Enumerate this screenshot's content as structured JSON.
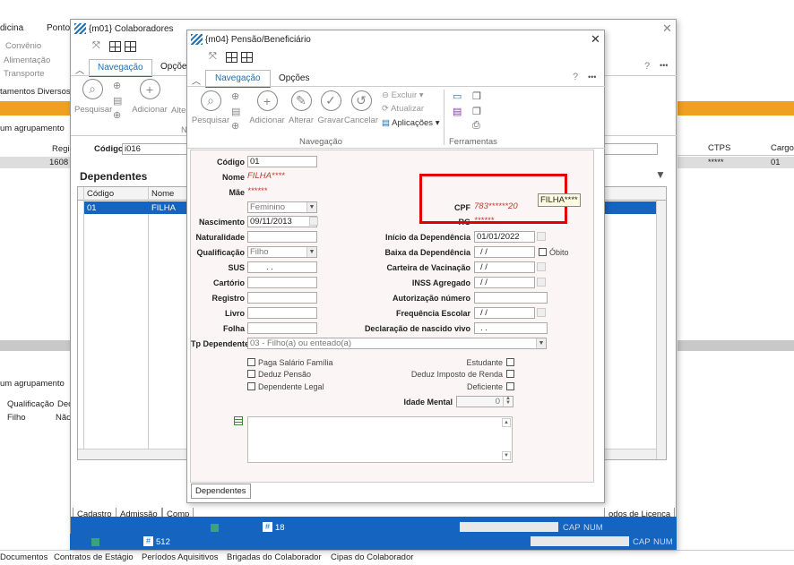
{
  "bg": {
    "menu": [
      "dicina",
      "Ponto"
    ],
    "side_items": [
      "Convênio",
      "Alimentação",
      "Transporte",
      "tamentos Diversos"
    ],
    "agrupamento1": "um agrupamento",
    "agrupamento2": "um agrupamento",
    "col_regi": "Regi",
    "row_value": "1608",
    "ctps_header": "CTPS",
    "cargo_header": "Cargo",
    "ctps_value": "*****",
    "cargo_value": "01",
    "qual_headers": [
      "Qualificação",
      "Dec"
    ],
    "qual_values": [
      "Filho",
      "Não"
    ],
    "bottom_links": [
      "Documentos",
      "Contratos de Estágio",
      "Períodos Aquisitivos",
      "Brigadas do Colaborador",
      "Cipas do Colaborador"
    ],
    "status_num": "512",
    "status_cap": "CAP",
    "status_num_label": "NUM"
  },
  "win1": {
    "title": "{m01} Colaboradores",
    "tab_nav": "Navegação",
    "tab_opc": "Opções",
    "pesquisar": "Pesquisar",
    "adicionar": "Adicionar",
    "alterar": "Alter",
    "n_label": "N",
    "codigo_label": "Código",
    "codigo_value": "i016",
    "dependentes_title": "Dependentes",
    "col_codigo": "Código",
    "col_nome": "Nome",
    "row_codigo": "01",
    "row_nome": "FILHA",
    "tabs": [
      "Cadastro",
      "Admissão",
      "Comp"
    ],
    "licenca_tab": "odos de Licença",
    "status_num": "18",
    "status_cap": "CAP",
    "status_num_label": "NUM"
  },
  "win2": {
    "title": "{m04} Pensão/Beneficiário",
    "tab_nav": "Navegação",
    "tab_opc": "Opções",
    "help": "?",
    "more": "•••",
    "buttons": {
      "pesquisar": "Pesquisar",
      "adicionar": "Adicionar",
      "alterar": "Alterar",
      "gravar": "Gravar",
      "cancelar": "Cancelar"
    },
    "group_nav": "Navegação",
    "excluir": "Excluir",
    "atualizar": "Atualizar",
    "aplicacoes": "Aplicações",
    "group_ferr": "Ferramentas",
    "form": {
      "codigo_label": "Código",
      "codigo_value": "01",
      "nome_label": "Nome",
      "nome_value": "FILHA****",
      "mae_label": "Mãe",
      "mae_value": "******",
      "sexo_value": "Feminino",
      "cpf_label": "CPF",
      "cpf_value": "783******20",
      "rg_label": "RG",
      "rg_value": "******",
      "tooltip": "FILHA****",
      "nasc_label": "Nascimento",
      "nasc_value": "09/11/2013",
      "nat_label": "Naturalidade",
      "qual_label": "Qualificação",
      "qual_value": "Filho",
      "sus_label": "SUS",
      "sus_value": ". .",
      "cartorio_label": "Cartório",
      "registro_label": "Registro",
      "livro_label": "Livro",
      "folha_label": "Folha",
      "ini_dep_label": "Início da Dependência",
      "ini_dep_value": "01/01/2022",
      "baixa_label": "Baixa da Dependência",
      "baixa_value": "/ /",
      "obito_label": "Óbito",
      "vac_label": "Carteira de Vacinação",
      "vac_value": "/ /",
      "inss_label": "INSS Agregado",
      "inss_value": "/ /",
      "aut_label": "Autorização número",
      "freq_label": "Frequência Escolar",
      "freq_value": "/ /",
      "decl_label": "Declaração de nascido vivo",
      "decl_value": ". .",
      "tp_label": "Tp Dependente",
      "tp_value": "03 - Filho(a) ou enteado(a)",
      "paga_sal": "Paga Salário Família",
      "deduz_pensao": "Deduz Pensão",
      "dep_legal": "Dependente Legal",
      "estudante": "Estudante",
      "deduz_ir": "Deduz Imposto de Renda",
      "deficiente": "Deficiente",
      "idade_label": "Idade Mental",
      "idade_value": "0"
    },
    "bottom_tab": "Dependentes"
  },
  "colors": {
    "accent": "#1f6fb2",
    "status_bar": "#1565c0",
    "highlight_box": "#e00000",
    "mask_text": "#c0392b"
  }
}
